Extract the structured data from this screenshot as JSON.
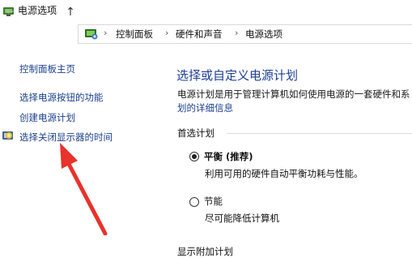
{
  "window": {
    "title": "电源选项"
  },
  "nav": {
    "back": "←",
    "forward": "→",
    "dropdown": "⌄",
    "up": "↑"
  },
  "breadcrumb": [
    "控制面板",
    "硬件和声音",
    "电源选项"
  ],
  "breadcrumb_sep": "›",
  "sidebar": {
    "items": [
      {
        "label": "控制面板主页"
      },
      {
        "label": "选择电源按钮的功能"
      },
      {
        "label": "创建电源计划"
      },
      {
        "label": "选择关闭显示器的时间"
      }
    ]
  },
  "main": {
    "title": "选择或自定义电源计划",
    "description_line1": "电源计划是用于管理计算机如何使用电源的一套硬件和系",
    "description_link": "划的详细信息",
    "preferred_label": "首选计划",
    "plans": [
      {
        "name": "平衡 (推荐)",
        "description": "利用可用的硬件自动平衡功耗与性能。",
        "selected": true
      },
      {
        "name": "节能",
        "description": "尽可能降低计算机",
        "selected": false
      }
    ],
    "more_plans_label": "显示附加计划"
  },
  "annotation": {
    "arrow_color": "#e8322c"
  },
  "colors": {
    "link": "#1b3f8f",
    "title": "#1c3f95"
  }
}
